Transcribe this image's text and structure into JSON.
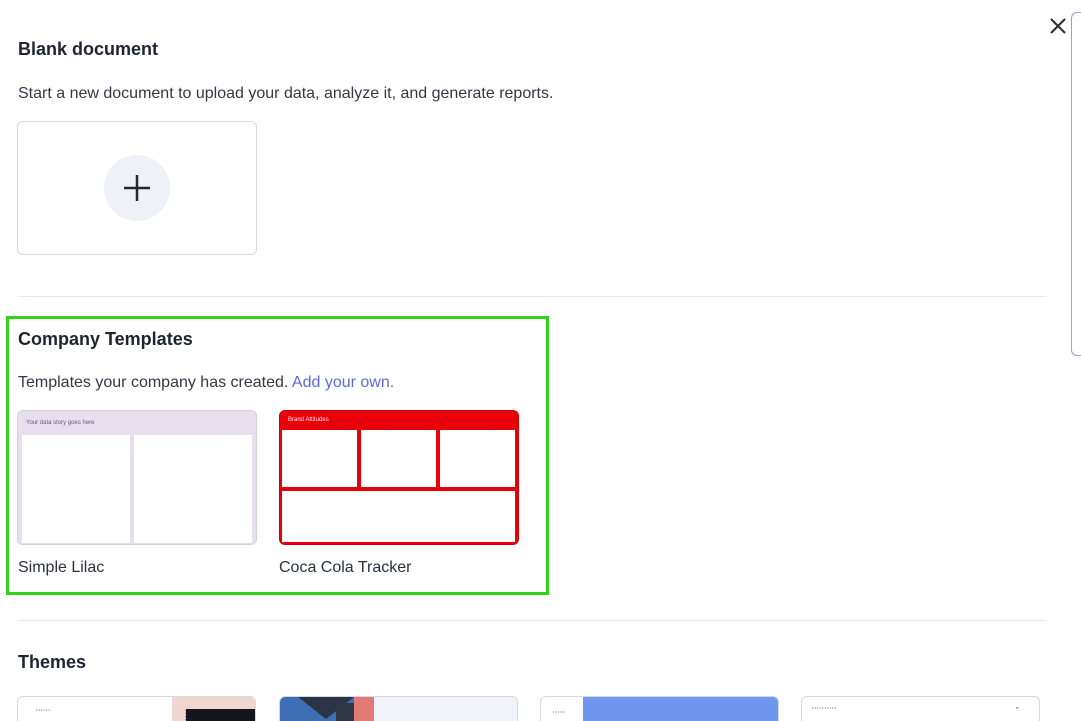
{
  "dialog": {
    "close_icon": "close-icon",
    "close_label": "Close"
  },
  "blank": {
    "title": "Blank document",
    "description": "Start a new document to upload your data, analyze it, and generate reports.",
    "add_icon": "plus-icon"
  },
  "company_templates": {
    "title": "Company Templates",
    "description": "Templates your company has created.",
    "add_link": "Add your own.",
    "highlight_color": "#2fd31a",
    "items": [
      {
        "name": "Simple Lilac",
        "preview_header": "Your data story goes here",
        "preview_color": "#e8dfee"
      },
      {
        "name": "Coca Cola Tracker",
        "preview_header": "Brand Attitudes",
        "preview_color": "#e8000a"
      }
    ]
  },
  "themes": {
    "title": "Themes",
    "items": [
      {
        "preview_text": "• • • • • •",
        "accent": "#f2d4d1"
      },
      {
        "preview_text": "",
        "accent": "#3e6fb4"
      },
      {
        "preview_text": "• • • • •",
        "accent": "#6f96ef"
      },
      {
        "preview_text": "• • • • • • • • • •",
        "accent": "#ffffff"
      }
    ]
  },
  "colors": {
    "link": "#5b6bdc",
    "card_border": "#d5d8de"
  }
}
